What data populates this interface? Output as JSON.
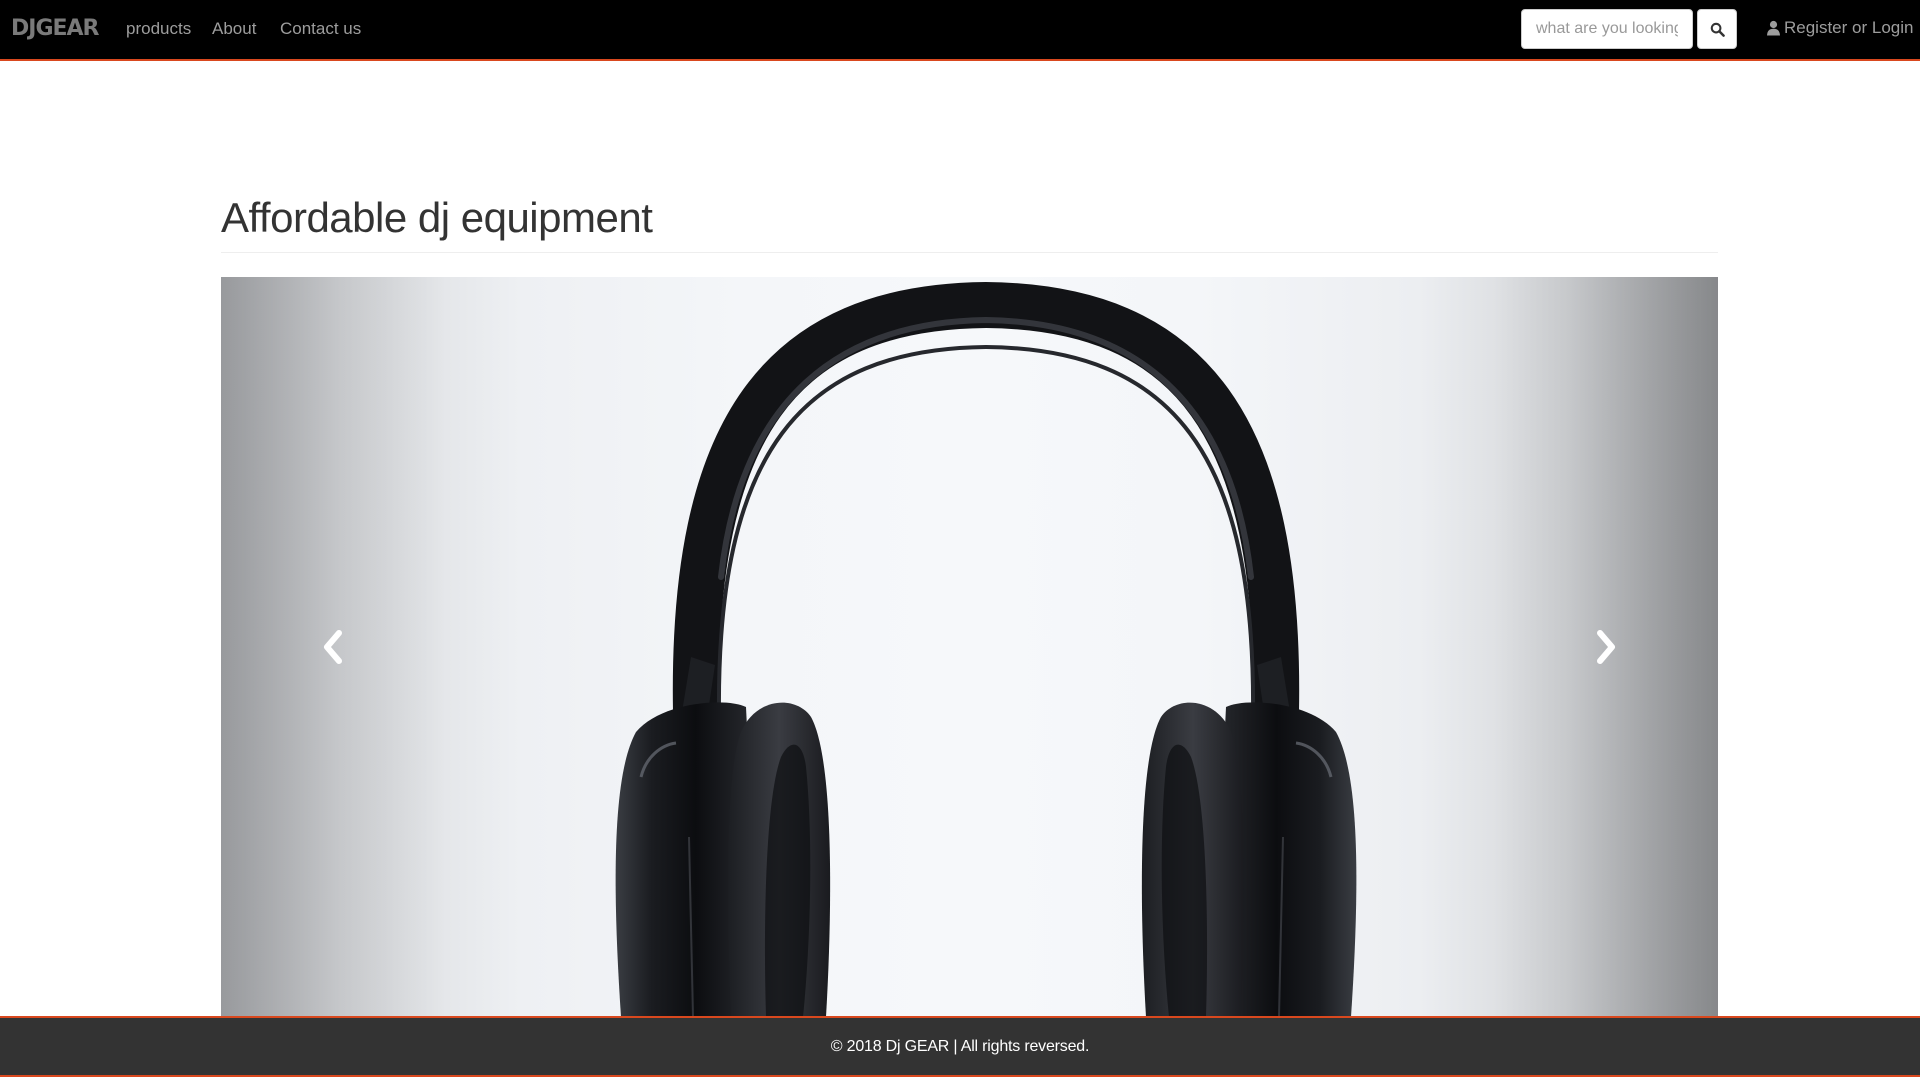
{
  "navbar": {
    "brand": "DJGEAR",
    "links": [
      {
        "label": "products"
      },
      {
        "label": "About"
      },
      {
        "label": "Contact us"
      }
    ],
    "search": {
      "placeholder": "what are you looking for",
      "value": ""
    },
    "search_button_icon": "search-icon",
    "account_icon": "user-icon",
    "account_label": "Register or Login"
  },
  "main": {
    "title": "Affordable dj equipment",
    "carousel": {
      "image": "headphones",
      "prev_icon": "chevron-left-icon",
      "next_icon": "chevron-right-icon"
    }
  },
  "footer": {
    "text": "© 2018 Dj GEAR | All rights reversed."
  },
  "colors": {
    "navbar_bg": "#000000",
    "accent": "#d9481e",
    "footer_bg": "#333333",
    "nav_text": "#9d9d9d",
    "title_text": "#333333"
  }
}
